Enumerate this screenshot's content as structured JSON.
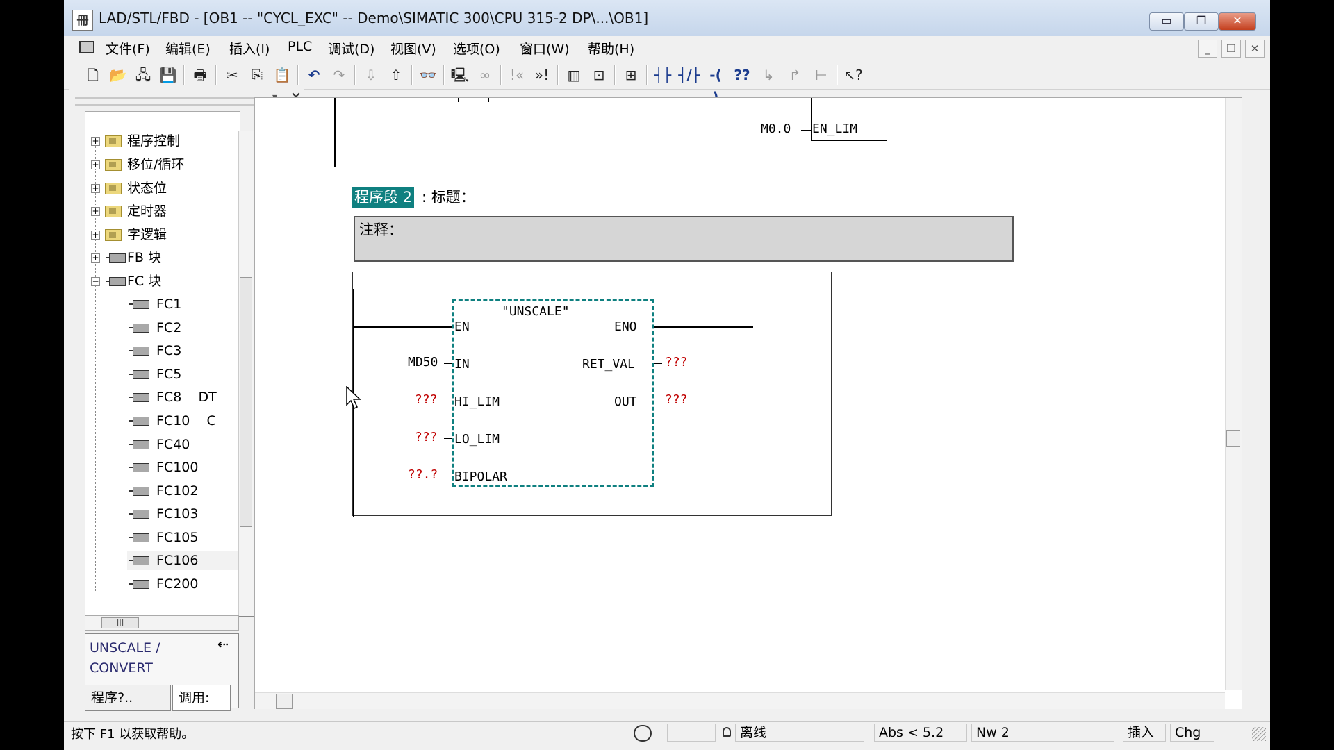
{
  "window": {
    "title": "LAD/STL/FBD  - [OB1 -- \"CYCL_EXC\" -- Demo\\SIMATIC 300\\CPU 315-2 DP\\...\\OB1]",
    "app_icon_text": "冊",
    "minimize": "▭",
    "maximize": "❐",
    "close": "✕"
  },
  "menubar": {
    "items": [
      "文件(F)",
      "编辑(E)",
      "插入(I)",
      "PLC",
      "调试(D)",
      "视图(V)",
      "选项(O)",
      "窗口(W)",
      "帮助(H)"
    ],
    "mdi_minimize": "_",
    "mdi_restore": "❐",
    "mdi_close": "✕"
  },
  "toolbar": {
    "buttons": [
      {
        "name": "new-icon",
        "glyph": "🗋"
      },
      {
        "name": "open-icon",
        "glyph": "📂"
      },
      {
        "name": "accessible-nodes-icon",
        "glyph": "🖧"
      },
      {
        "name": "save-icon",
        "glyph": "💾"
      },
      {
        "name": "print-icon",
        "glyph": "🖶"
      },
      {
        "name": "cut-icon",
        "glyph": "✂"
      },
      {
        "name": "copy-icon",
        "glyph": "⎘"
      },
      {
        "name": "paste-icon",
        "glyph": "📋"
      },
      {
        "name": "undo-icon",
        "glyph": "↶"
      },
      {
        "name": "redo-icon",
        "glyph": "↷"
      },
      {
        "name": "download-icon",
        "glyph": "⇩"
      },
      {
        "name": "upload-icon",
        "glyph": "⇧"
      },
      {
        "name": "monitor-icon",
        "glyph": "👓"
      },
      {
        "name": "network-icon",
        "glyph": "🖳"
      },
      {
        "name": "glasses-icon",
        "glyph": "∞"
      },
      {
        "name": "previous-network-icon",
        "glyph": "!«"
      },
      {
        "name": "next-network-icon",
        "glyph": "»!"
      },
      {
        "name": "overview-icon",
        "glyph": "▥"
      },
      {
        "name": "details-icon",
        "glyph": "⊡"
      },
      {
        "name": "new-network-icon",
        "glyph": "⊞"
      },
      {
        "name": "no-contact-icon",
        "glyph": "┤├"
      },
      {
        "name": "nc-contact-icon",
        "glyph": "┤/├"
      },
      {
        "name": "coil-icon",
        "glyph": "-( )"
      },
      {
        "name": "empty-box-icon",
        "glyph": "??"
      },
      {
        "name": "open-branch-icon",
        "glyph": "↳"
      },
      {
        "name": "close-branch-icon",
        "glyph": "↱"
      },
      {
        "name": "connection-icon",
        "glyph": "⊢"
      },
      {
        "name": "help-pointer-icon",
        "glyph": "↖?"
      }
    ]
  },
  "left_pane": {
    "tree": [
      {
        "label": "程序控制",
        "expander": "+",
        "type": "folder"
      },
      {
        "label": "移位/循环",
        "expander": "+",
        "type": "folder"
      },
      {
        "label": "状态位",
        "expander": "+",
        "type": "folder"
      },
      {
        "label": "定时器",
        "expander": "+",
        "type": "folder"
      },
      {
        "label": "字逻辑",
        "expander": "+",
        "type": "folder"
      },
      {
        "label": "FB 块",
        "expander": "+",
        "type": "block"
      },
      {
        "label": "FC 块",
        "expander": "−",
        "type": "block"
      },
      {
        "label": "FC1",
        "type": "fc"
      },
      {
        "label": "FC2",
        "type": "fc"
      },
      {
        "label": "FC3",
        "type": "fc"
      },
      {
        "label": "FC5",
        "type": "fc"
      },
      {
        "label": "FC8    DT",
        "type": "fc"
      },
      {
        "label": "FC10    C",
        "type": "fc"
      },
      {
        "label": "FC40",
        "type": "fc"
      },
      {
        "label": "FC100",
        "type": "fc"
      },
      {
        "label": "FC102",
        "type": "fc"
      },
      {
        "label": "FC103",
        "type": "fc"
      },
      {
        "label": "FC105",
        "type": "fc"
      },
      {
        "label": "FC106",
        "type": "fc"
      },
      {
        "label": "FC200",
        "type": "fc"
      }
    ],
    "info_text": "UNSCALE / CONVERT",
    "info_button": "⇠",
    "tabs": [
      "程序?..",
      "调用:"
    ],
    "pin_glyph": "▾",
    "close_glyph": "×",
    "hscroll_grip": "III"
  },
  "editor": {
    "prev_network": {
      "contact": "M0.0",
      "pin": "EN_LIM"
    },
    "network_label": "程序段 2",
    "network_title": ": 标题：",
    "comment_label": "注释：",
    "block": {
      "name": "\"UNSCALE\"",
      "inputs": [
        "EN",
        "IN",
        "HI_LIM",
        "LO_LIM",
        "BIPOLAR"
      ],
      "outputs": [
        "ENO",
        "RET_VAL",
        "OUT"
      ],
      "input_operands": [
        "",
        "MD50",
        "???",
        "???",
        "??.?"
      ],
      "output_operands": [
        "",
        "???",
        "???"
      ]
    }
  },
  "statusbar": {
    "help": "按下 F1 以获取帮助。",
    "mode": "离线",
    "position": "Abs < 5.2",
    "network": "Nw 2",
    "insert": "插入",
    "chg": "Chg"
  }
}
